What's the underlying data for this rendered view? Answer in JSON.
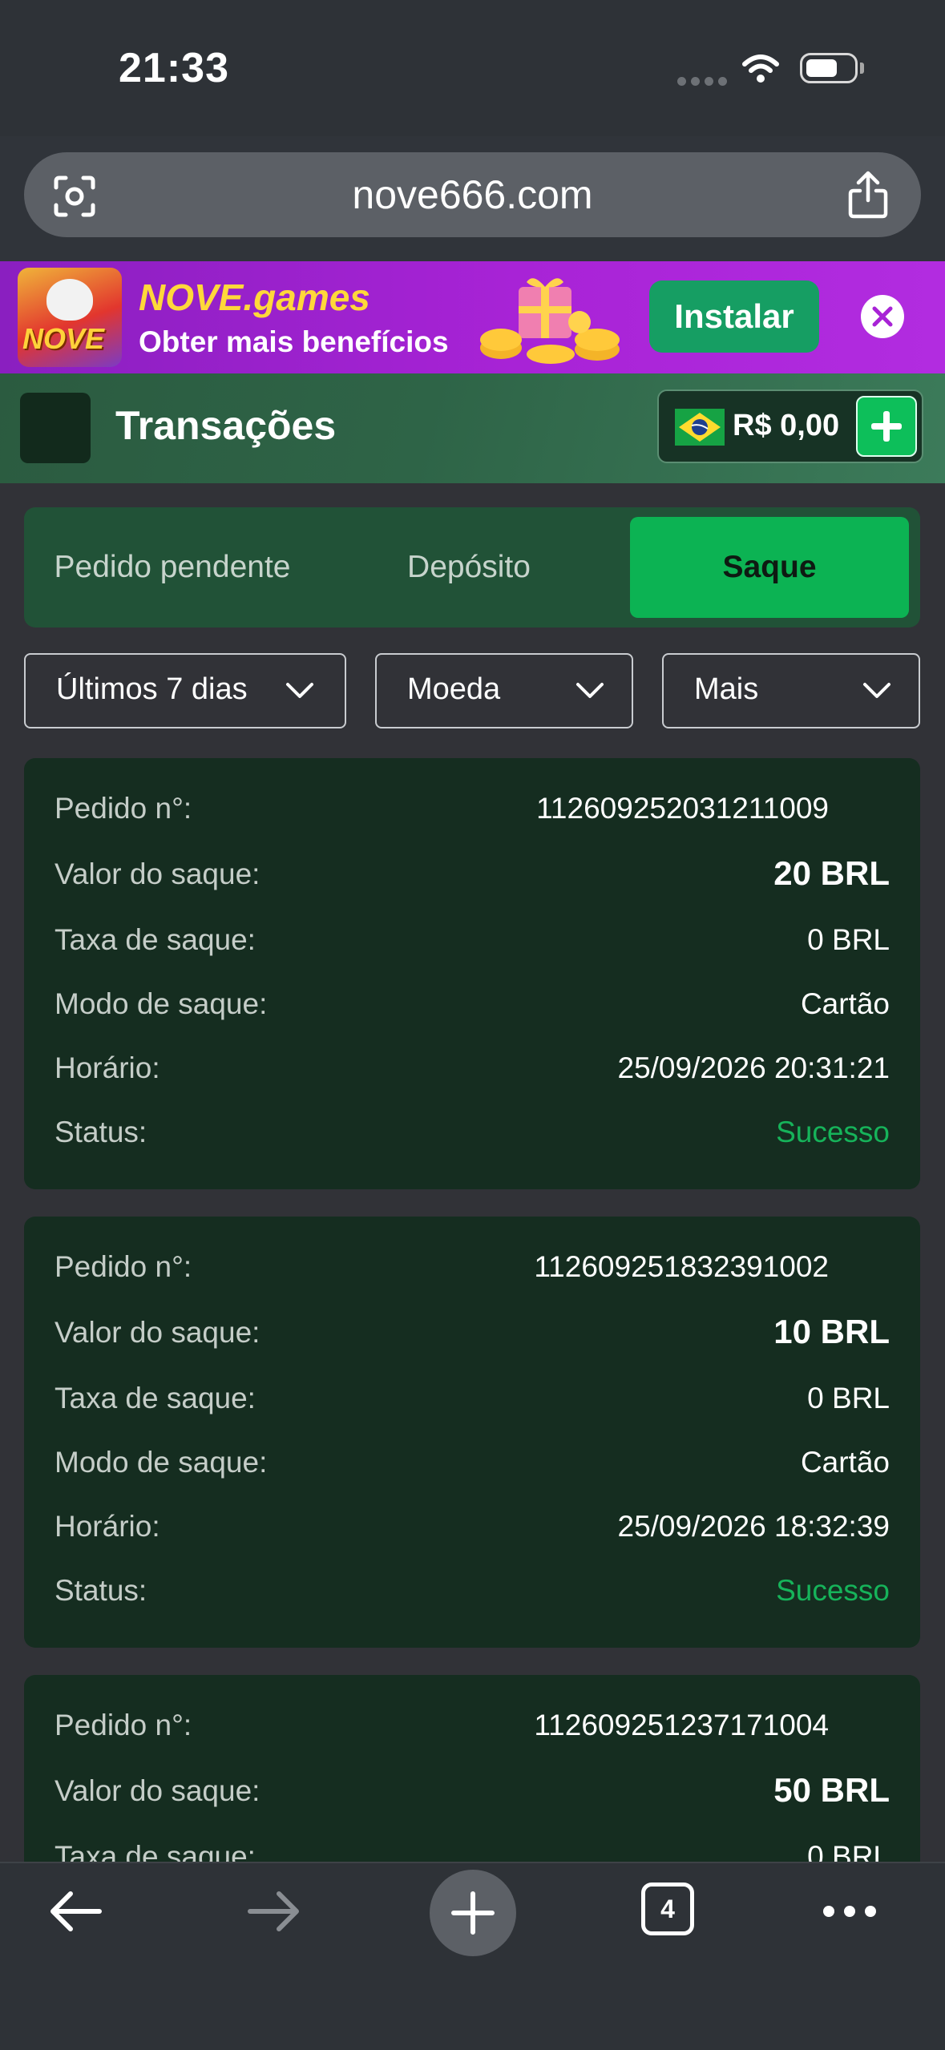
{
  "status_bar": {
    "time": "21:33"
  },
  "browser": {
    "url": "nove666.com",
    "tab_count": "4"
  },
  "promo": {
    "logo_text": "NOVE",
    "title": "NOVE.games",
    "subtitle": "Obter mais benefícios",
    "install_label": "Instalar"
  },
  "header": {
    "title": "Transações",
    "balance": "R$ 0,00"
  },
  "tabs": [
    {
      "label": "Pedido pendente"
    },
    {
      "label": "Depósito"
    },
    {
      "label": "Saque",
      "active": true
    }
  ],
  "filters": [
    {
      "label": "Últimos 7 dias"
    },
    {
      "label": "Moeda"
    },
    {
      "label": "Mais"
    }
  ],
  "field_labels": {
    "order": "Pedido n°:",
    "amount": "Valor do saque:",
    "fee": "Taxa de saque:",
    "mode": "Modo de saque:",
    "time": "Horário:",
    "status": "Status:"
  },
  "transactions": [
    {
      "order": "112609252031211009",
      "amount": "20 BRL",
      "fee": "0 BRL",
      "mode": "Cartão",
      "time": "25/09/2026 20:31:21",
      "status": "Sucesso"
    },
    {
      "order": "112609251832391002",
      "amount": "10 BRL",
      "fee": "0 BRL",
      "mode": "Cartão",
      "time": "25/09/2026 18:32:39",
      "status": "Sucesso"
    },
    {
      "order": "112609251237171004",
      "amount": "50 BRL",
      "fee": "0 BRL",
      "mode": "",
      "time": "",
      "status": ""
    }
  ],
  "colors": {
    "accent": "#0cb353",
    "success": "#16b35a",
    "card": "#152d20",
    "tab_bar": "#215237"
  }
}
